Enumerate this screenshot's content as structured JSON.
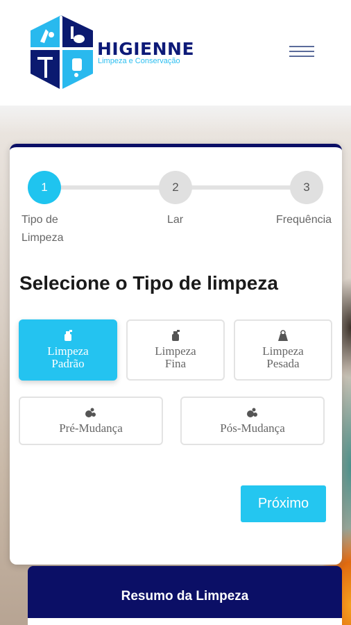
{
  "brand": {
    "name": "HIGIENNE",
    "tagline": "Limpeza e Conservação"
  },
  "header": {
    "menu_icon": "hamburger-icon"
  },
  "stepper": {
    "current": 1,
    "steps": [
      {
        "number": "1",
        "label": "Tipo de\nLimpeza"
      },
      {
        "number": "2",
        "label": "Lar"
      },
      {
        "number": "3",
        "label": "Frequência"
      }
    ]
  },
  "main": {
    "title": "Selecione o Tipo de limpeza",
    "options": [
      {
        "label": "Limpeza\nPadrão",
        "icon": "spray-bottle-icon",
        "selected": true
      },
      {
        "label": "Limpeza\nFina",
        "icon": "spray-bottle-icon",
        "selected": false
      },
      {
        "label": "Limpeza\nPesada",
        "icon": "weight-icon",
        "selected": false
      },
      {
        "label": "Pré-Mudança",
        "icon": "soap-bubbles-icon",
        "selected": false
      },
      {
        "label": "Pós-Mudança",
        "icon": "soap-bubbles-icon",
        "selected": false
      }
    ],
    "next_label": "Próximo"
  },
  "summary": {
    "title": "Resumo da Limpeza"
  },
  "colors": {
    "accent": "#1fc4ef",
    "navy": "#0b0f66",
    "brand_blue": "#0d1a78"
  }
}
